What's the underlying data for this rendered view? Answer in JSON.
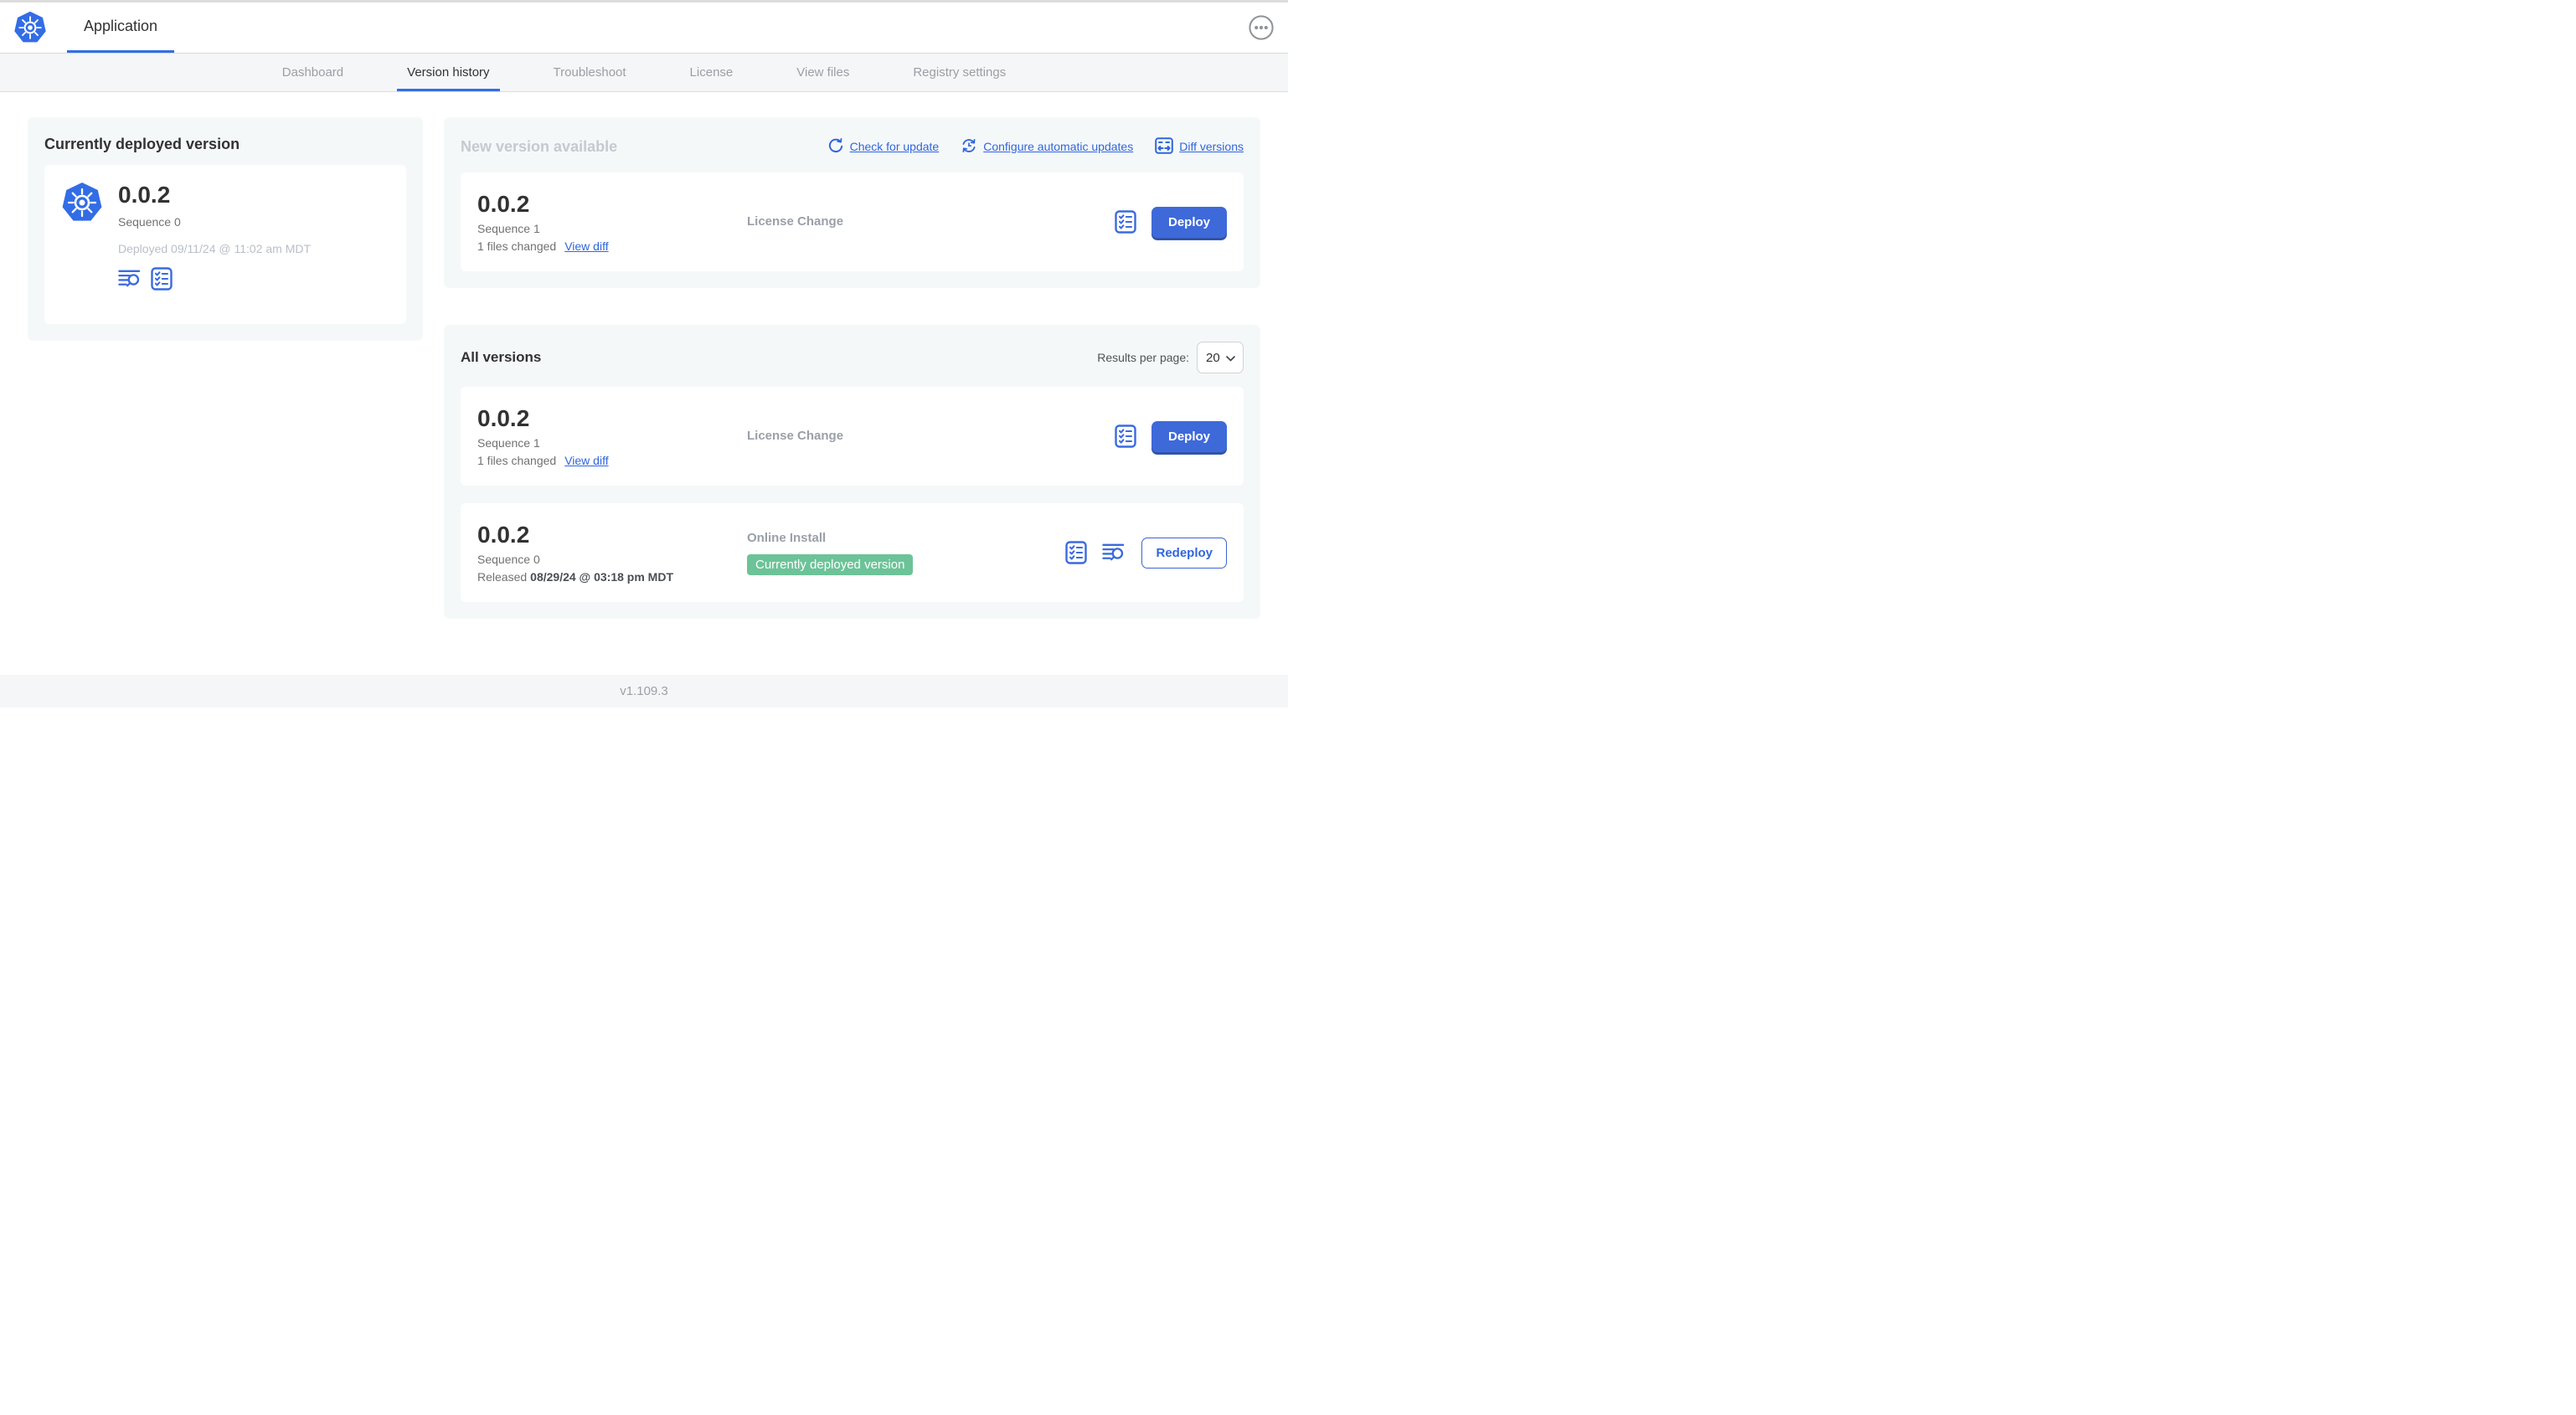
{
  "header": {
    "title": "Application"
  },
  "nav": {
    "tabs": [
      "Dashboard",
      "Version history",
      "Troubleshoot",
      "License",
      "View files",
      "Registry settings"
    ],
    "active": "Version history"
  },
  "current": {
    "title": "Currently deployed version",
    "version": "0.0.2",
    "sequence": "Sequence 0",
    "deployed_at": "Deployed 09/11/24 @ 11:02 am MDT"
  },
  "new_version": {
    "title": "New version available",
    "check_for_update": "Check for update",
    "configure_updates": "Configure automatic updates",
    "diff_versions": "Diff versions",
    "row": {
      "version": "0.0.2",
      "sequence": "Sequence 1",
      "files_changed": "1 files changed",
      "view_diff": "View diff",
      "source": "License Change",
      "action": "Deploy"
    }
  },
  "all_versions": {
    "title": "All versions",
    "results_per_page_label": "Results per page:",
    "results_per_page": "20",
    "rows": [
      {
        "version": "0.0.2",
        "sequence": "Sequence 1",
        "files_changed": "1 files changed",
        "view_diff": "View diff",
        "source": "License Change",
        "action": "Deploy"
      },
      {
        "version": "0.0.2",
        "sequence": "Sequence 0",
        "released_prefix": "Released",
        "released_date": "08/29/24 @ 03:18 pm MDT",
        "source": "Online Install",
        "badge": "Currently deployed version",
        "action": "Redeploy"
      }
    ]
  },
  "footer": {
    "version": "v1.109.3"
  },
  "colors": {
    "kubernetes_blue": "#326de6",
    "link_blue": "#3066db",
    "button_blue": "#3e69d9",
    "badge_green": "#6cc398"
  }
}
